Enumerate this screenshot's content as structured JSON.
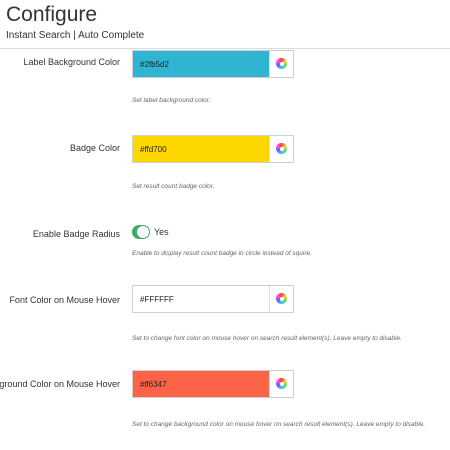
{
  "header": {
    "title": "Configure",
    "breadcrumb": "Instant Search | Auto Complete"
  },
  "settings": {
    "label_bg": {
      "label": "Label Background Color",
      "value": "#2fb5d2",
      "color": "#2fb5d2",
      "help": "Set label background color."
    },
    "badge_color": {
      "label": "Badge Color",
      "value": "#ffd700",
      "color": "#ffd700",
      "help": "Set result count badge color."
    },
    "badge_radius": {
      "label": "Enable Badge Radius",
      "toggle_label": "Yes",
      "enabled": true,
      "help": "Enable to display result count badge in circle instead of squire."
    },
    "font_hover": {
      "label": "Font Color on Mouse Hover",
      "value": "#FFFFFF",
      "color": "#ffffff",
      "help": "Set to change font color on mouse hover on search result element(s). Leave empty to disable."
    },
    "bg_hover": {
      "label": "Background Color on Mouse Hover",
      "value": "#ff6347",
      "color": "#ff6347",
      "help": "Set to change background color on mouse hover on search result element(s). Leave empty to disable."
    }
  },
  "icons": {
    "picker": "color-wheel-icon"
  }
}
